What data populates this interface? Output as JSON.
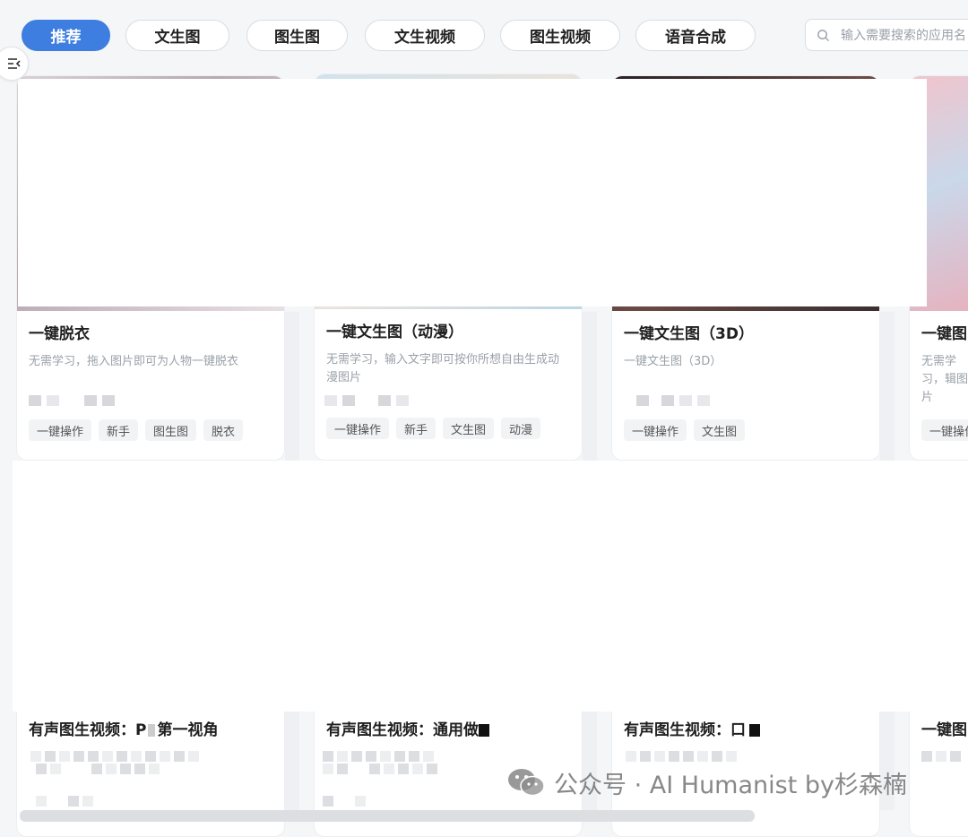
{
  "tabs": [
    {
      "label": "推荐",
      "active": true
    },
    {
      "label": "文生图",
      "active": false
    },
    {
      "label": "图生图",
      "active": false
    },
    {
      "label": "文生视频",
      "active": false
    },
    {
      "label": "图生视频",
      "active": false
    },
    {
      "label": "语音合成",
      "active": false
    }
  ],
  "search": {
    "placeholder": "输入需要搜索的应用名"
  },
  "cards_row1": [
    {
      "title": "一键脱衣",
      "desc": "无需学习，拖入图片即可为人物一键脱衣",
      "tags": [
        "一键操作",
        "新手",
        "图生图",
        "脱衣"
      ]
    },
    {
      "title": "一键文生图（动漫）",
      "desc": "无需学习，输入文字即可按你所想自由生成动漫图片",
      "tags": [
        "一键操作",
        "新手",
        "文生图",
        "动漫"
      ]
    },
    {
      "title": "一键文生图（3D）",
      "desc": "一键文生图（3D）",
      "tags": [
        "一键操作",
        "文生图"
      ]
    },
    {
      "title": "一键图",
      "desc": "无需学习，辑图片",
      "tags": [
        "一键操作"
      ]
    }
  ],
  "cards_row2": [
    {
      "title": "有声图生视频：P",
      "title_tail": "第一视角"
    },
    {
      "title": "有声图生视频：通用做",
      "title_tail": ""
    },
    {
      "title": "有声图生视频：口",
      "title_tail": ""
    },
    {
      "title": "一键图",
      "title_tail": ""
    }
  ],
  "watermark": {
    "text": "公众号 · AI Humanist by杉森楠"
  },
  "colors": {
    "accent": "#3d7ee0",
    "page_bg": "#f5f6f8"
  }
}
